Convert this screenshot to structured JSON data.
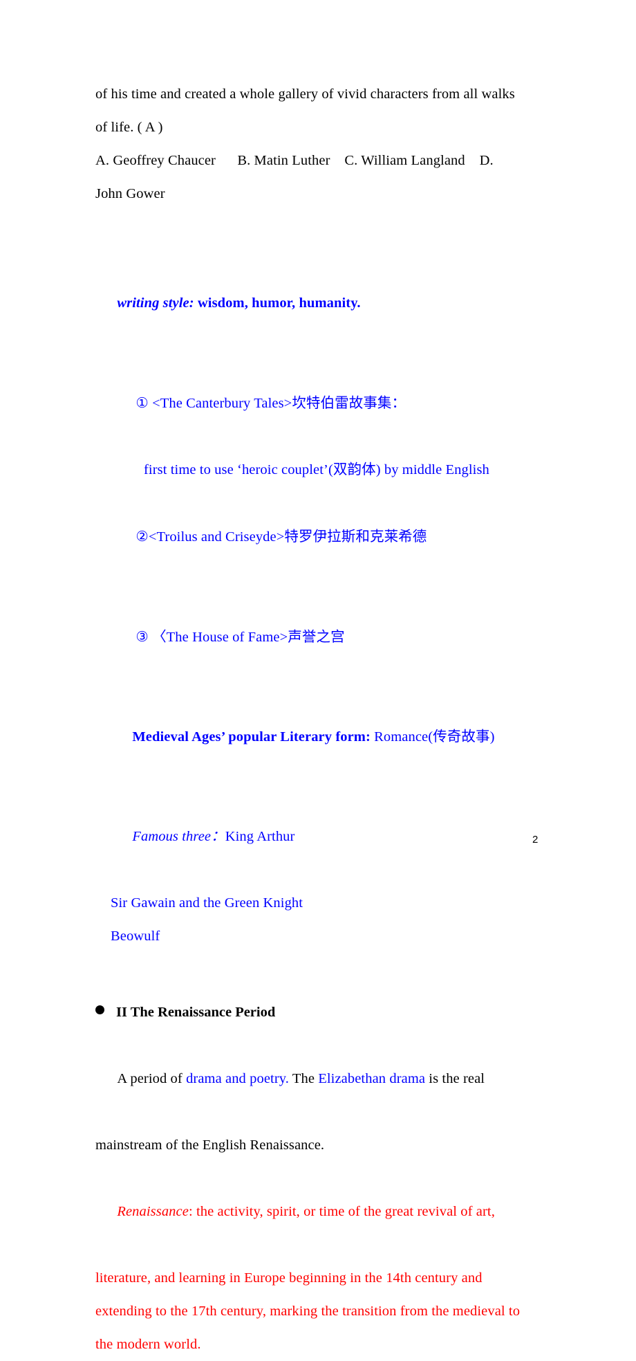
{
  "document": {
    "page_number": "2",
    "colors": {
      "text_black": "#000000",
      "text_blue": "#0000ff",
      "text_red": "#ff0000"
    }
  },
  "quiz": {
    "stem_line_1": "of his time and created a whole gallery of vivid characters from all walks",
    "stem_line_2": "of life. ( A )",
    "options_line_1": "A. Geoffrey Chaucer      B. Matin Luther    C. William Langland    D.",
    "options_line_2": "John Gower"
  },
  "notes": {
    "writing_style_label": "writing style:",
    "writing_style_value": " wisdom, humor, humanity.",
    "work_1_marker": "①",
    "work_1_text": " <The Canterbury Tales>坎特伯雷故事集：",
    "work_1_note": "first time to use ‘heroic couplet’(双韵体) by middle English",
    "work_2_marker": "②",
    "work_2_text": "<Troilus and Criseyde>特罗伊拉斯和克莱希德",
    "work_3_marker": "③",
    "work_3_text": " 〈The House of Fame>声誉之宫",
    "medieval_label": "Medieval Ages’ popular Literary form:",
    "medieval_value": " Romance(传奇故事)",
    "famous_three_label": "Famous three：",
    "famous_three_item_1": "King Arthur",
    "famous_three_item_2": "Sir Gawain and the Green Knight",
    "famous_three_item_3": "Beowulf"
  },
  "renaissance": {
    "heading": "II The Renaissance Period",
    "intro_1_a": "A period of ",
    "intro_1_b": "drama and poetry.",
    "intro_1_c": " The ",
    "intro_1_d": "Elizabethan drama",
    "intro_1_e": " is the real",
    "intro_2": "mainstream of the English Renaissance.",
    "definition_term": "Renaissance",
    "definition_line_1": ": the activity, spirit, or time of the great revival of art,",
    "definition_line_2": "literature, and learning in Europe beginning in the 14th century and",
    "definition_line_3": "extending to the 17th century, marking the transition from the medieval to",
    "definition_line_4": "the modern world."
  }
}
